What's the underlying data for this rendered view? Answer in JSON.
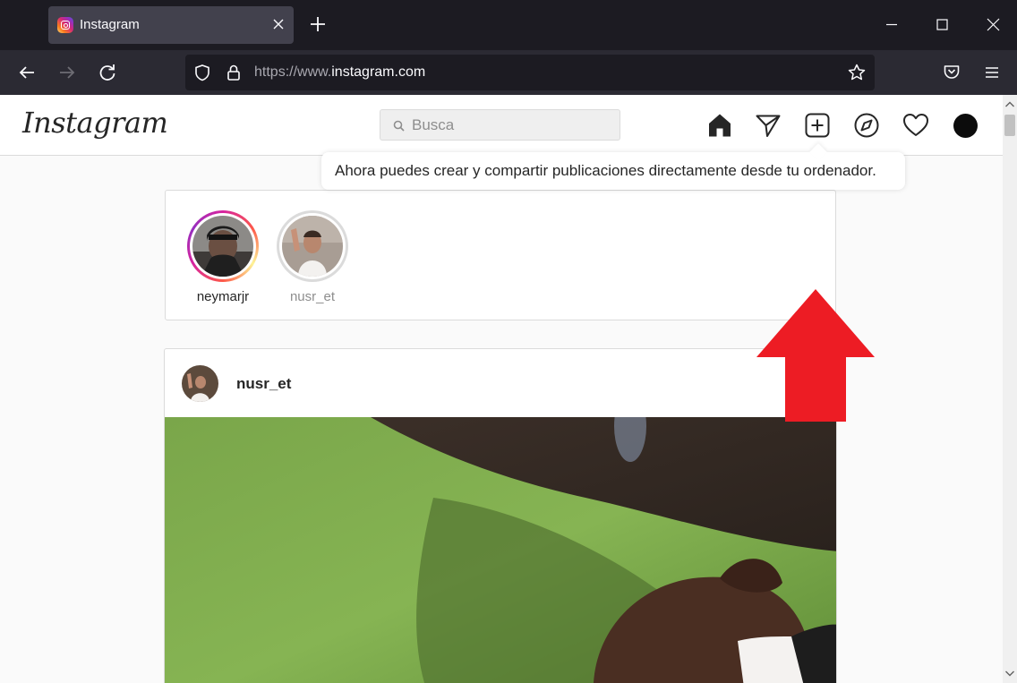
{
  "browser": {
    "tab": {
      "title": "Instagram",
      "favicon": "instagram-favicon"
    },
    "url": {
      "prefix": "https://www.",
      "host": "instagram.com"
    },
    "icons": [
      "back-icon",
      "forward-icon",
      "reload-icon",
      "shield-icon",
      "lock-icon",
      "star-icon",
      "pocket-icon",
      "menu-icon",
      "minimize-icon",
      "maximize-icon",
      "close-icon",
      "new-tab-icon"
    ]
  },
  "instagram": {
    "logo": "Instagram",
    "search": {
      "placeholder": "Busca",
      "value": ""
    },
    "nav": [
      "home-icon",
      "direct-icon",
      "new-post-icon",
      "explore-icon",
      "activity-icon",
      "profile-avatar"
    ],
    "tooltip": "Ahora puedes crear y compartir publicaciones directamente desde tu ordenador.",
    "stories": [
      {
        "username": "neymarjr",
        "seen": false
      },
      {
        "username": "nusr_et",
        "seen": true
      }
    ],
    "post": {
      "username": "nusr_et"
    }
  },
  "colors": {
    "accent": "#ed1c24",
    "text": "#262626",
    "muted": "#8e8e8e",
    "border": "#dbdbdb",
    "chrome_dark": "#1c1b22",
    "chrome_toolbar": "#2b2a33"
  }
}
